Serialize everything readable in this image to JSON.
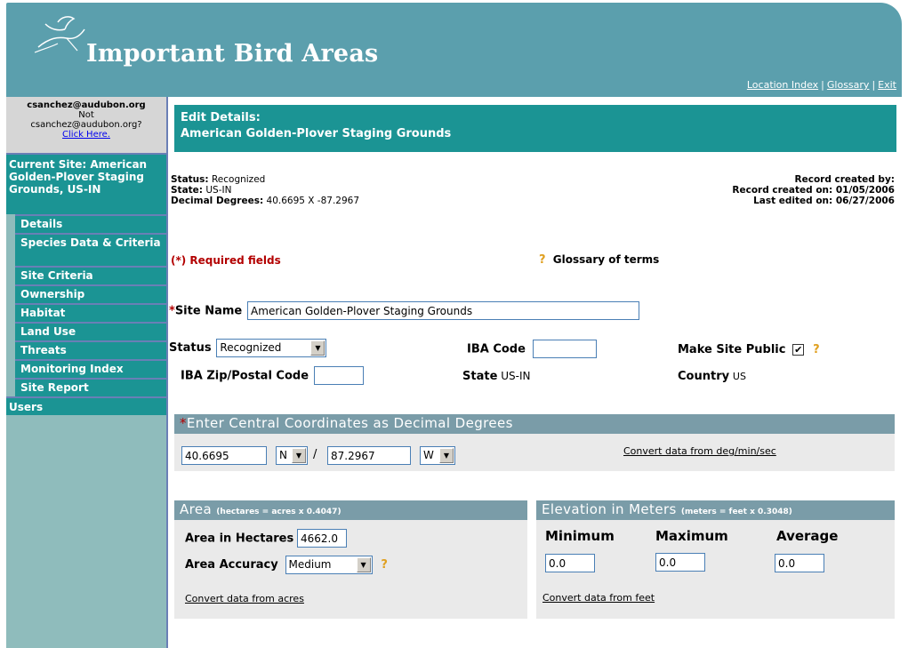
{
  "header": {
    "title": "Important Bird Areas",
    "links": [
      "Location Index",
      "Glossary",
      "Exit"
    ]
  },
  "sidebar": {
    "user_email": "csanchez@audubon.org",
    "not_text": "Not",
    "not_email": "csanchez@audubon.org?",
    "click_here": "Click Here.",
    "current_site": "Current Site: American Golden-Plover Staging Grounds, US-IN",
    "nav": [
      "Details",
      "Species Data & Criteria",
      "Site Criteria",
      "Ownership",
      "Habitat",
      "Land Use",
      "Threats",
      "Monitoring Index",
      "Site Report"
    ],
    "users": "Users"
  },
  "banner": {
    "line1": "Edit Details:",
    "line2": "American Golden-Plover Staging Grounds"
  },
  "status": {
    "status_label": "Status:",
    "status_value": "Recognized",
    "state_label": "State:",
    "state_value": "US-IN",
    "dd_label": "Decimal Degrees:",
    "dd_value": "40.6695 X -87.2967"
  },
  "record": {
    "created_by": "Record created by:",
    "created_on_label": "Record created on:",
    "created_on": "01/05/2006",
    "edited_label": "Last edited on:",
    "edited_on": "06/27/2006"
  },
  "form": {
    "required_note": "(*) Required fields",
    "glossary_terms": "Glossary of terms",
    "site_name_star": "*",
    "site_name_label": "Site Name",
    "site_name_value": "American Golden-Plover Staging Grounds",
    "status_label": "Status",
    "status_value": "Recognized",
    "iba_code_label": "IBA Code",
    "iba_code_value": "",
    "make_public_label": "Make Site Public",
    "make_public_checked": true,
    "zip_label": "IBA Zip/Postal Code",
    "zip_value": "",
    "state_label": "State",
    "state_value": "US-IN",
    "country_label": "Country",
    "country_value": "US"
  },
  "coords": {
    "star": "*",
    "title": "Enter Central Coordinates as Decimal Degrees",
    "lat": "40.6695",
    "lat_dir": "N",
    "slash": "/",
    "lon": "87.2967",
    "lon_dir": "W",
    "convert_link": "Convert data from deg/min/sec"
  },
  "area": {
    "title": "Area",
    "note": "(hectares = acres x 0.4047)",
    "hectares_label": "Area in Hectares",
    "hectares_value": "4662.0",
    "accuracy_label": "Area Accuracy",
    "accuracy_value": "Medium",
    "convert_link": "Convert data from acres"
  },
  "elevation": {
    "title": "Elevation in Meters",
    "note": "(meters = feet x 0.3048)",
    "min_label": "Minimum",
    "max_label": "Maximum",
    "avg_label": "Average",
    "min_value": "0.0",
    "max_value": "0.0",
    "avg_value": "0.0",
    "convert_link": "Convert data from feet"
  },
  "help_glyph": "?"
}
